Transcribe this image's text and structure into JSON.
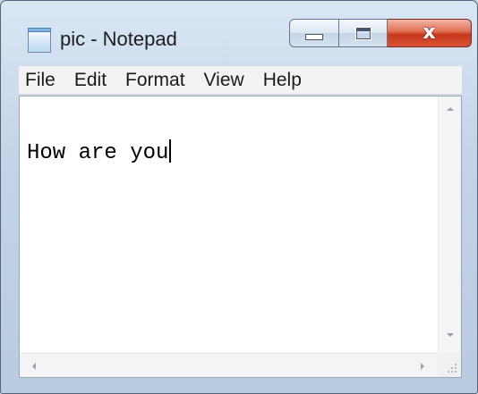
{
  "window": {
    "title": "pic - Notepad",
    "controls": {
      "minimize_icon": "minimize-icon",
      "maximize_icon": "maximize-icon",
      "close_icon": "close-icon",
      "close_glyph": "x"
    },
    "colors": {
      "close_button": "#d8543a",
      "frame": "#c3d4e8"
    }
  },
  "menu": {
    "items": [
      {
        "label": "File"
      },
      {
        "label": "Edit"
      },
      {
        "label": "Format"
      },
      {
        "label": "View"
      },
      {
        "label": "Help"
      }
    ]
  },
  "editor": {
    "content": "How are you",
    "scrollbars": {
      "up_icon": "scroll-up-arrow-icon",
      "down_icon": "scroll-down-arrow-icon",
      "left_icon": "scroll-left-arrow-icon",
      "right_icon": "scroll-right-arrow-icon"
    }
  }
}
